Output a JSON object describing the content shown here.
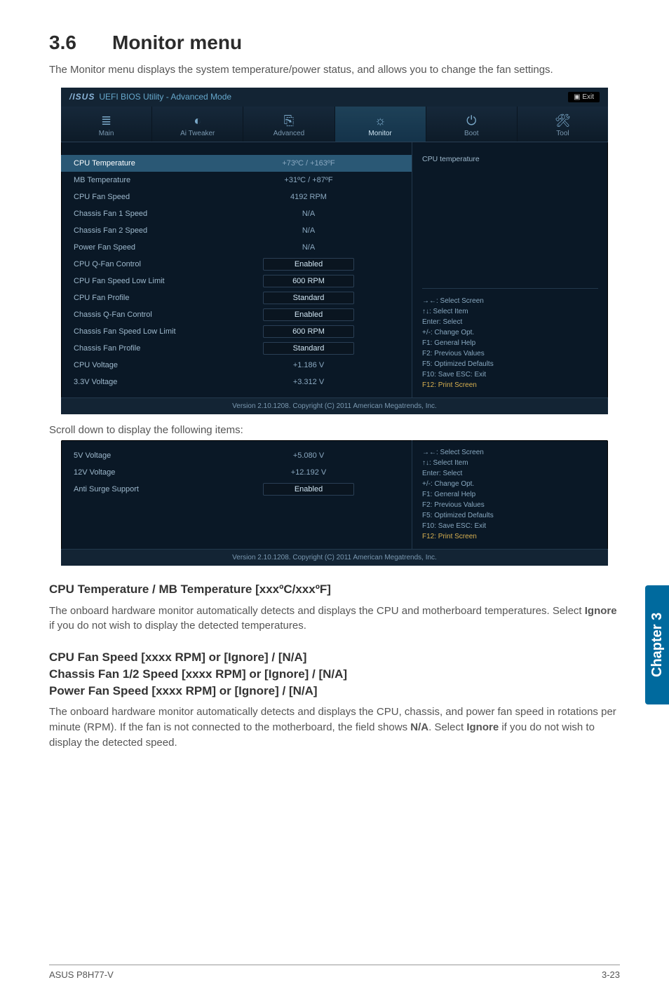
{
  "section": {
    "num": "3.6",
    "title": "Monitor menu"
  },
  "intro": "The Monitor menu displays the system temperature/power status, and allows you to change the fan settings.",
  "bios1": {
    "titlebar": {
      "brand": "/ISUS",
      "util": "UEFI BIOS Utility - Advanced Mode",
      "exit": "Exit"
    },
    "tabs": [
      {
        "icon": "≣",
        "label": "Main"
      },
      {
        "icon": "◐",
        "label": "Ai Tweaker"
      },
      {
        "icon": "⎘",
        "label": "Advanced"
      },
      {
        "icon": "☼",
        "label": "Monitor",
        "active": true
      },
      {
        "icon": "⏻",
        "label": "Boot"
      },
      {
        "icon": "🛠",
        "label": "Tool"
      }
    ],
    "right_top": "CPU temperature",
    "rows": [
      {
        "label": "CPU Temperature",
        "value": "+73ºC / +163ºF",
        "sel": true
      },
      {
        "label": "MB Temperature",
        "value": "+31ºC / +87ºF"
      },
      {
        "label": "CPU Fan Speed",
        "value": "4192 RPM"
      },
      {
        "label": "Chassis Fan 1 Speed",
        "value": "N/A"
      },
      {
        "label": "Chassis Fan 2 Speed",
        "value": "N/A"
      },
      {
        "label": "Power Fan Speed",
        "value": "N/A"
      },
      {
        "label": "CPU Q-Fan Control",
        "value": "Enabled",
        "boxed": true
      },
      {
        "label": "CPU Fan Speed Low Limit",
        "value": "600 RPM",
        "boxed": true
      },
      {
        "label": " CPU Fan Profile",
        "value": "Standard",
        "boxed": true
      },
      {
        "label": "Chassis Q-Fan Control",
        "value": "Enabled",
        "boxed": true
      },
      {
        "label": "Chassis Fan Speed Low Limit",
        "value": "600 RPM",
        "boxed": true
      },
      {
        "label": " Chassis Fan Profile",
        "value": "Standard",
        "boxed": true
      },
      {
        "label": "CPU Voltage",
        "value": "+1.186 V"
      },
      {
        "label": "3.3V Voltage",
        "value": "+3.312 V"
      }
    ],
    "help": [
      "→←: Select Screen",
      "↑↓: Select Item",
      "Enter: Select",
      "+/-: Change Opt.",
      "F1: General Help",
      "F2: Previous Values",
      "F5: Optimized Defaults",
      "F10: Save   ESC: Exit",
      "F12: Print Screen"
    ],
    "footer": "Version 2.10.1208.  Copyright (C) 2011 American Megatrends, Inc."
  },
  "scroll_note": "Scroll down to display the following items:",
  "bios2": {
    "rows": [
      {
        "label": "5V Voltage",
        "value": "+5.080 V"
      },
      {
        "label": "12V Voltage",
        "value": "+12.192 V"
      },
      {
        "label": "Anti Surge Support",
        "value": "Enabled",
        "boxed": true
      }
    ],
    "help": [
      "→←: Select Screen",
      "↑↓: Select Item",
      "Enter: Select",
      "+/-: Change Opt.",
      "F1: General Help",
      "F2: Previous Values",
      "F5: Optimized Defaults",
      "F10: Save   ESC: Exit",
      "F12: Print Screen"
    ],
    "footer": "Version 2.10.1208.  Copyright (C) 2011 American Megatrends, Inc."
  },
  "sec1": {
    "heading": "CPU Temperature / MB Temperature [xxxºC/xxxºF]",
    "body_a": "The onboard hardware monitor automatically detects and displays the CPU and motherboard temperatures. Select ",
    "bold": "Ignore",
    "body_b": " if you do not wish to display the detected temperatures."
  },
  "sec2": {
    "h1": "CPU Fan Speed [xxxx RPM] or [Ignore] / [N/A]",
    "h2": "Chassis Fan 1/2 Speed [xxxx RPM] or [Ignore] / [N/A]",
    "h3": "Power Fan Speed [xxxx RPM] or [Ignore] / [N/A]",
    "body_a": "The onboard hardware monitor automatically detects and displays the CPU, chassis, and power fan speed in rotations per minute (RPM). If the fan is not connected to the motherboard, the field shows ",
    "bold1": "N/A",
    "body_b": ". Select ",
    "bold2": "Ignore",
    "body_c": " if you do not wish to display the detected speed."
  },
  "sidetab": "Chapter 3",
  "footer": {
    "left": "ASUS P8H77-V",
    "right": "3-23"
  }
}
